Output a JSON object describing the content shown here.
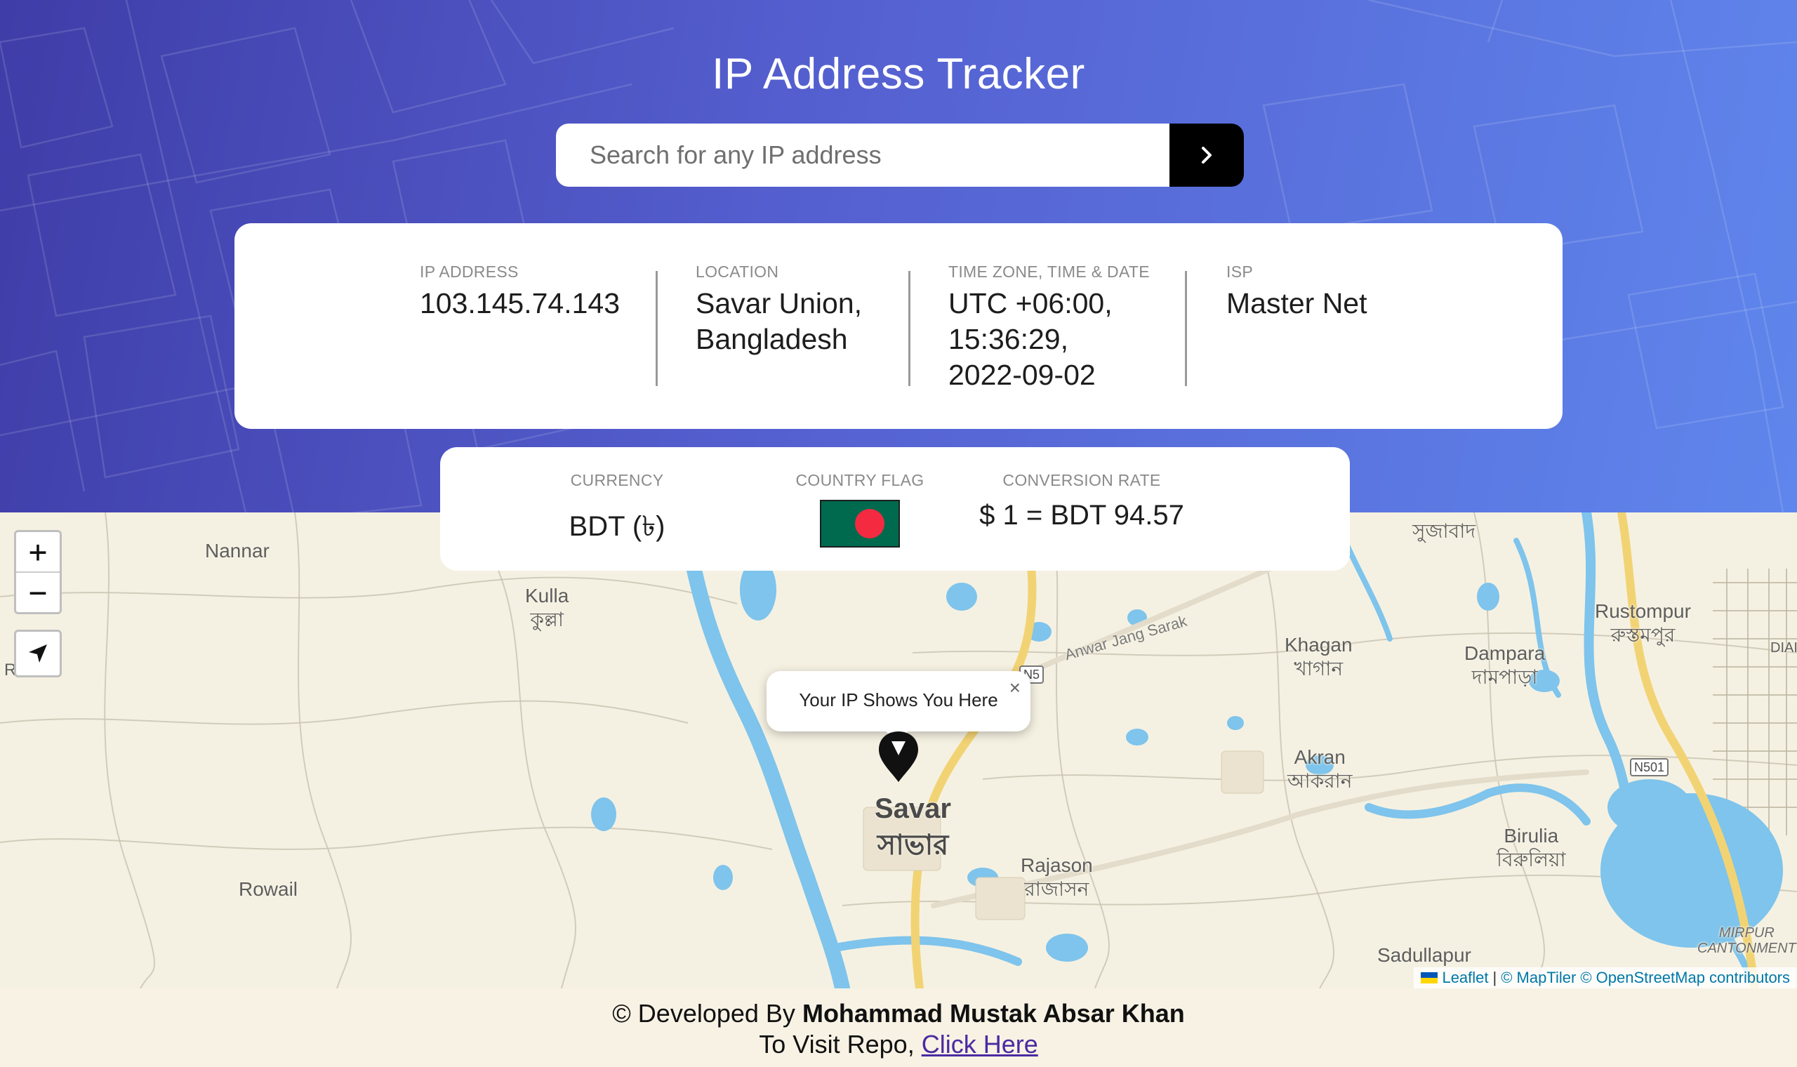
{
  "header": {
    "title": "IP Address Tracker",
    "search_placeholder": "Search for any IP address",
    "search_button_icon": "chevron-right-icon"
  },
  "info": {
    "ip_label": "IP ADDRESS",
    "ip_value": "103.145.74.143",
    "location_label": "LOCATION",
    "location_value_1": "Savar Union,",
    "location_value_2": "Bangladesh",
    "timezone_label": "TIME ZONE, TIME & DATE",
    "timezone_value_1": "UTC +06:00,",
    "timezone_value_2": "15:36:29,",
    "timezone_value_3": "2022-09-02",
    "isp_label": "ISP",
    "isp_value": "Master Net"
  },
  "currency": {
    "currency_label": "CURRENCY",
    "currency_value": "BDT (৳)",
    "flag_label": "COUNTRY FLAG",
    "flag_country": "Bangladesh",
    "rate_label": "CONVERSION RATE",
    "rate_value": "$ 1 = BDT 94.57"
  },
  "map": {
    "zoom_in": "+",
    "zoom_out": "−",
    "popup_text": "Your IP Shows You Here",
    "popup_close": "×",
    "labels": {
      "nannar": "Nannar",
      "kulla_en": "Kulla",
      "kulla_bn": "কুল্লা",
      "rowail": "Rowail",
      "rowail_partial": "R a",
      "savar_en": "Savar",
      "savar_bn": "সাভার",
      "rajason_en": "Rajason",
      "rajason_bn": "রাজাসন",
      "khagan_en": "Khagan",
      "khagan_bn": "খাগান",
      "dampara_en": "Dampara",
      "dampara_bn": "দামপাড়া",
      "akran_en": "Akran",
      "akran_bn": "আকরান",
      "birulia_en": "Birulia",
      "birulia_bn": "বিরুলিয়া",
      "rustompur_en": "Rustompur",
      "rustompur_bn": "রুস্তমপুর",
      "sujabad_bn": "সুজাবাদ",
      "sadullapur": "Sadullapur",
      "mirpur": "MIRPUR",
      "cantonment": "CANTONMENT",
      "diabari_partial": "DIAI",
      "road": "Anwar Jang Sarak",
      "shield_n5": "N5",
      "shield_n501": "N501"
    },
    "attribution": {
      "leaflet": "Leaflet",
      "sep": "|",
      "maptiler": "© MapTiler",
      "osm": "© OpenStreetMap contributors"
    }
  },
  "footer": {
    "prefix": "© Developed By",
    "developer": "Mohammad Mustak Absar Khan",
    "repo_text": "To Visit Repo,",
    "repo_link": "Click Here"
  },
  "colors": {
    "header_start": "#3f3da8",
    "header_end": "#5f86ec",
    "water": "#7ec4ec",
    "road": "#f2d374",
    "flag_green": "#006a4e",
    "flag_red": "#f42a41"
  }
}
